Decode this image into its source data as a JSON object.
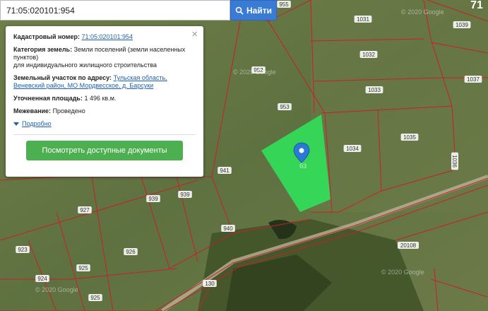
{
  "search": {
    "value": "71:05:020101:954",
    "button_label": "Найти"
  },
  "popup": {
    "cadastral_label": "Кадастровый номер:",
    "cadastral_value": "71:05:020101:954",
    "category_label": "Категория земель:",
    "category_value": "Земли поселений (земли населенных пунктов)",
    "category_use": "для индивидуального жилищного строительства",
    "address_label": "Земельный участок по адресу:",
    "address_value": "Тульская область, Веневский район, МО Мордвесское, д. Барсуки",
    "area_label": "Уточненная площадь:",
    "area_value": "1 496 кв.м.",
    "survey_label": "Межевание:",
    "survey_value": "Проведено",
    "more_link": "Подробно",
    "docs_button": "Посмотреть доступные документы"
  },
  "map": {
    "parcel_labels": [
      "955",
      "1031",
      "1039",
      "1032",
      "1037",
      "952",
      "1033",
      "953",
      "1035",
      "1034",
      "1036",
      "941",
      "939",
      "939",
      "927",
      "940",
      "926",
      "923",
      "925",
      "924",
      "925",
      "130",
      "20108",
      "71"
    ],
    "watermarks": [
      "2020 Google",
      "2020 Google",
      "2020 Google",
      "2020 Google"
    ],
    "colors": {
      "selected_parcel": "#31e05a",
      "boundary": "#c8202a",
      "marker": "#2a7ad4"
    }
  }
}
